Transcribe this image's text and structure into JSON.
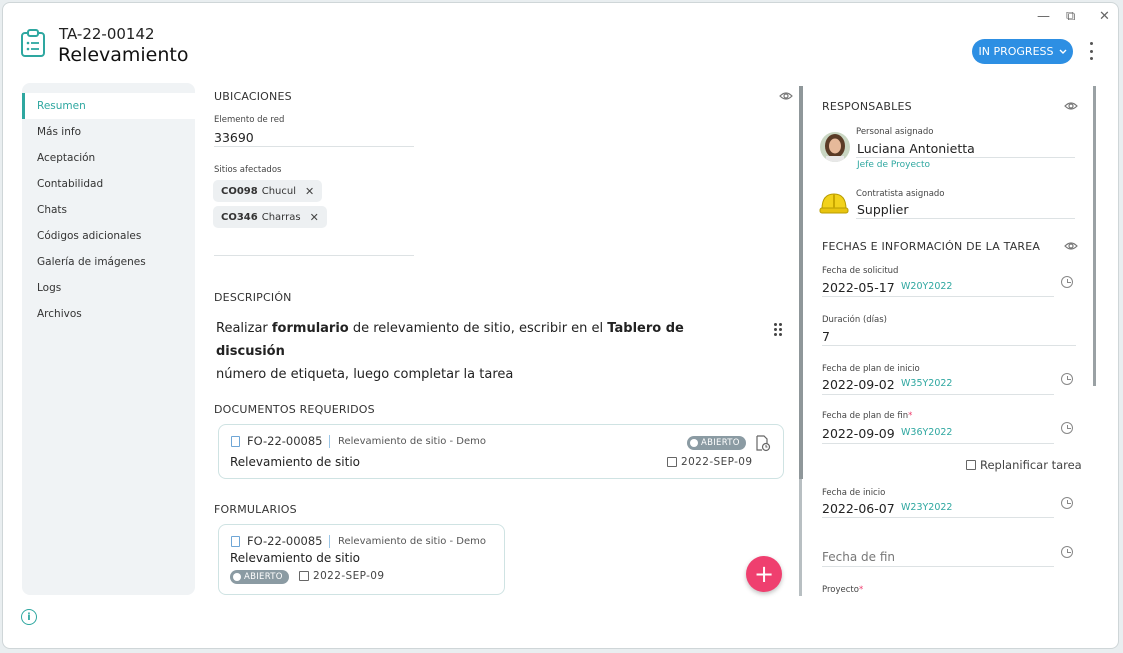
{
  "window": {
    "minimize": "—",
    "restore": "⧉",
    "close": "✕"
  },
  "header": {
    "code": "TA-22-00142",
    "title": "Relevamiento",
    "status": "IN PROGRESS",
    "status_color": "#2d8fe3",
    "icon": "clipboard-icon"
  },
  "sidebar": {
    "items": [
      {
        "label": "Resumen",
        "active": true
      },
      {
        "label": "Más info"
      },
      {
        "label": "Aceptación"
      },
      {
        "label": "Contabilidad"
      },
      {
        "label": "Chats"
      },
      {
        "label": "Códigos adicionales"
      },
      {
        "label": "Galería de imágenes"
      },
      {
        "label": "Logs"
      },
      {
        "label": "Archivos"
      }
    ]
  },
  "ubicaciones": {
    "title": "UBICACIONES",
    "elemento_label": "Elemento de red",
    "elemento_value": "33690",
    "sitios_label": "Sitios afectados",
    "sitios": [
      {
        "code": "CO098",
        "name": "Chucul"
      },
      {
        "code": "CO346",
        "name": "Charras"
      }
    ]
  },
  "descripcion": {
    "title": "DESCRIPCIÓN",
    "p1": "Realizar ",
    "b1": "formulario",
    "p2": " de relevamiento de sitio, escribir en el ",
    "b2": "Tablero de discusión",
    "p3": "número de etiqueta, luego completar la tarea"
  },
  "documentos": {
    "title": "DOCUMENTOS REQUERIDOS",
    "items": [
      {
        "code": "FO-22-00085",
        "sub": "Relevamiento de sitio - Demo",
        "name": "Relevamiento de sitio",
        "status": "ABIERTO",
        "date": "2022-SEP-09"
      }
    ]
  },
  "formularios": {
    "title": "FORMULARIOS",
    "items": [
      {
        "code": "FO-22-00085",
        "sub": "Relevamiento de sitio - Demo",
        "name": "Relevamiento de sitio",
        "status": "ABIERTO",
        "date": "2022-SEP-09"
      }
    ]
  },
  "fab": "+",
  "responsables": {
    "title": "RESPONSABLES",
    "personal_label": "Personal asignado",
    "personal_name": "Luciana Antonietta",
    "personal_role": "Jefe de Proyecto",
    "contratista_label": "Contratista asignado",
    "contratista_name": "Supplier"
  },
  "fechas": {
    "title": "FECHAS E INFORMACIÓN DE LA TAREA",
    "solicitud_label": "Fecha de solicitud",
    "solicitud_value": "2022-05-17",
    "solicitud_week": "W20Y2022",
    "duracion_label": "Duración (días)",
    "duracion_value": "7",
    "plan_inicio_label": "Fecha de plan de inicio",
    "plan_inicio_value": "2022-09-02",
    "plan_inicio_week": "W35Y2022",
    "plan_fin_label": "Fecha de plan de fin",
    "plan_fin_value": "2022-09-09",
    "plan_fin_week": "W36Y2022",
    "replanificar": "Replanificar tarea",
    "inicio_label": "Fecha de inicio",
    "inicio_value": "2022-06-07",
    "inicio_week": "W23Y2022",
    "fin_placeholder": "Fecha de fin",
    "proyecto_label": "Proyecto",
    "required_mark": "*"
  }
}
